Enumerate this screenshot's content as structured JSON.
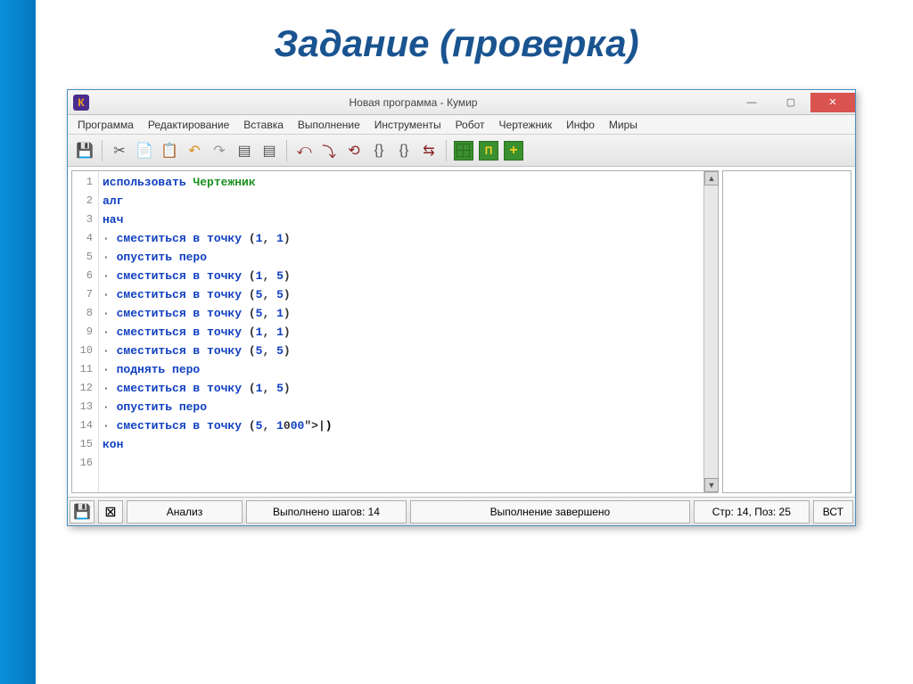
{
  "slide": {
    "title": "Задание (проверка)"
  },
  "window": {
    "app_icon": "К",
    "title": "Новая программа - Кумир"
  },
  "menu": {
    "items": [
      "Программа",
      "Редактирование",
      "Вставка",
      "Выполнение",
      "Инструменты",
      "Робот",
      "Чертежник",
      "Инфо",
      "Миры"
    ]
  },
  "code": {
    "lines": [
      {
        "n": 1,
        "type": "use",
        "kw": "использовать",
        "ident": "Чертежник"
      },
      {
        "n": 2,
        "type": "kw",
        "text": "алг"
      },
      {
        "n": 3,
        "type": "kw",
        "text": "нач"
      },
      {
        "n": 4,
        "type": "cmd",
        "cmd": "сместиться в точку",
        "args": "(1, 1)"
      },
      {
        "n": 5,
        "type": "cmd",
        "cmd": "опустить перо",
        "args": ""
      },
      {
        "n": 6,
        "type": "cmd",
        "cmd": "сместиться в точку",
        "args": "(1, 5)"
      },
      {
        "n": 7,
        "type": "cmd",
        "cmd": "сместиться в точку",
        "args": "(5, 5)"
      },
      {
        "n": 8,
        "type": "cmd",
        "cmd": "сместиться в точку",
        "args": "(5, 1)"
      },
      {
        "n": 9,
        "type": "cmd",
        "cmd": "сместиться в точку",
        "args": "(1, 1)"
      },
      {
        "n": 10,
        "type": "cmd",
        "cmd": "сместиться в точку",
        "args": "(5, 5)"
      },
      {
        "n": 11,
        "type": "cmd",
        "cmd": "поднять перо",
        "args": ""
      },
      {
        "n": 12,
        "type": "cmd",
        "cmd": "сместиться в точку",
        "args": "(1, 5)"
      },
      {
        "n": 13,
        "type": "cmd",
        "cmd": "опустить перо",
        "args": ""
      },
      {
        "n": 14,
        "type": "cmd",
        "cmd": "сместиться в точку",
        "args": "(5, 1|)"
      },
      {
        "n": 15,
        "type": "kw",
        "text": "кон"
      },
      {
        "n": 16,
        "type": "blank",
        "text": ""
      }
    ]
  },
  "status": {
    "analyze": "Анализ",
    "steps": "Выполнено шагов: 14",
    "state": "Выполнение завершено",
    "pos": "Стр: 14, Поз: 25",
    "mode": "ВСТ"
  }
}
